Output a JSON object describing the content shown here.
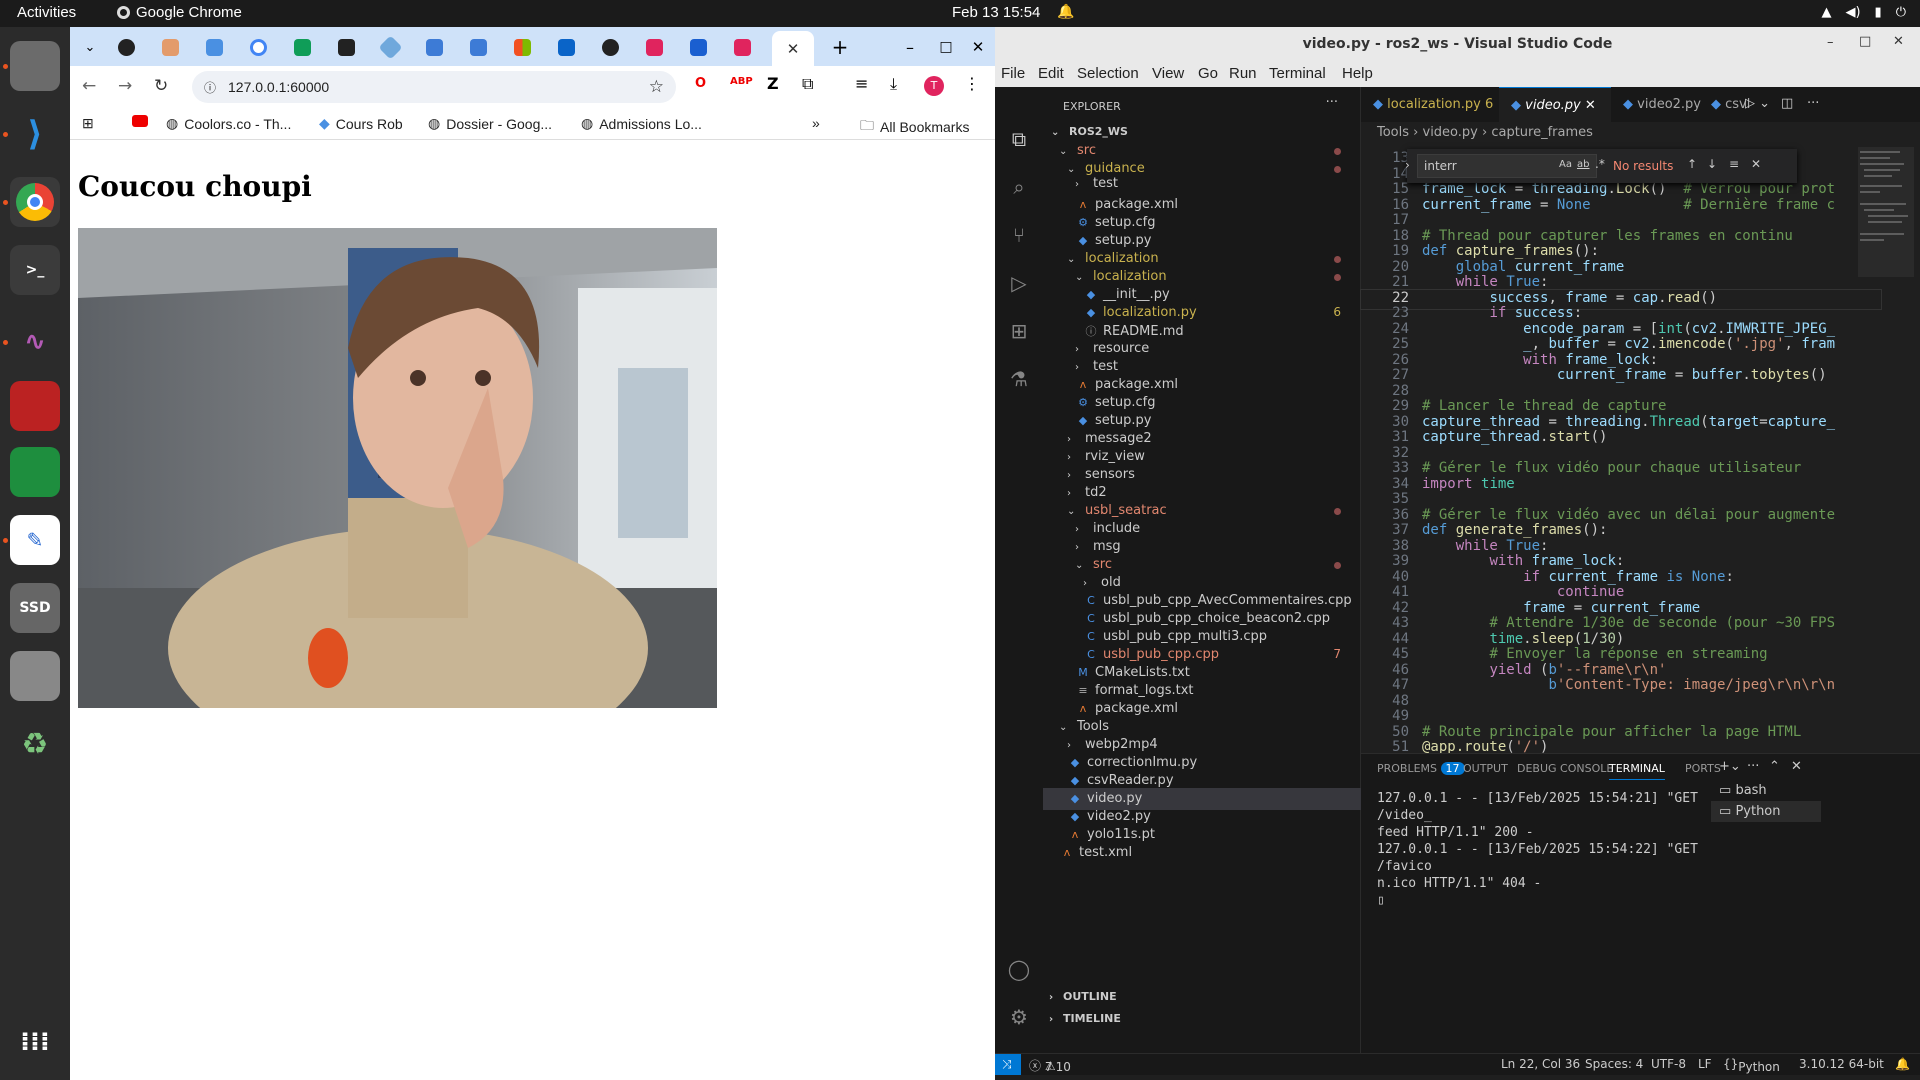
{
  "topbar": {
    "activities": "Activities",
    "app": "Google Chrome",
    "clock": "Feb 13  15:54"
  },
  "browser": {
    "url": "127.0.0.1:60000",
    "all_bookmarks": "All Bookmarks",
    "bookmarks": [
      "Coolors.co - Th...",
      "Cours Rob",
      "Dossier - Goog...",
      "Admissions Lo..."
    ],
    "page_heading": "Coucou choupi",
    "avatar_letter": "T"
  },
  "vscode": {
    "title": "video.py - ros2_ws - Visual Studio Code",
    "menu": [
      "File",
      "Edit",
      "Selection",
      "View",
      "Go",
      "Run",
      "Terminal",
      "Help"
    ],
    "explorer_label": "EXPLORER",
    "tabs": [
      {
        "label": "localization.py",
        "badge": "6"
      },
      {
        "label": "video.py"
      },
      {
        "label": "video2.py"
      },
      {
        "label": "csvl"
      }
    ],
    "breadcrumb": [
      "Tools",
      "video.py",
      "capture_frames"
    ],
    "find": {
      "value": "interr",
      "result": "No results",
      "aa": "Aa",
      "ab": "ab"
    },
    "tree": [
      {
        "label": "ROS2_WS",
        "indent": 0,
        "type": "root",
        "open": true
      },
      {
        "label": "src",
        "indent": 1,
        "type": "folder",
        "open": true,
        "color": "#e2876f",
        "dot": true
      },
      {
        "label": "guidance",
        "indent": 2,
        "type": "folder",
        "open": true,
        "color": "#c9b24e",
        "dot": true
      },
      {
        "label": "test",
        "indent": 3,
        "type": "folder",
        "open": false,
        "clip": true
      },
      {
        "label": "package.xml",
        "indent": 3,
        "type": "xml"
      },
      {
        "label": "setup.cfg",
        "indent": 3,
        "type": "cfg"
      },
      {
        "label": "setup.py",
        "indent": 3,
        "type": "py"
      },
      {
        "label": "localization",
        "indent": 2,
        "type": "folder",
        "open": true,
        "color": "#c9b24e",
        "dot": true
      },
      {
        "label": "localization",
        "indent": 3,
        "type": "folder",
        "open": true,
        "color": "#c9b24e",
        "dot": true
      },
      {
        "label": "__init__.py",
        "indent": 4,
        "type": "py"
      },
      {
        "label": "localization.py",
        "indent": 4,
        "type": "py",
        "color": "#c9b24e",
        "badge": "6"
      },
      {
        "label": "README.md",
        "indent": 4,
        "type": "info"
      },
      {
        "label": "resource",
        "indent": 3,
        "type": "folder",
        "open": false
      },
      {
        "label": "test",
        "indent": 3,
        "type": "folder",
        "open": false
      },
      {
        "label": "package.xml",
        "indent": 3,
        "type": "xml"
      },
      {
        "label": "setup.cfg",
        "indent": 3,
        "type": "cfg"
      },
      {
        "label": "setup.py",
        "indent": 3,
        "type": "py"
      },
      {
        "label": "message2",
        "indent": 2,
        "type": "folder",
        "open": false
      },
      {
        "label": "rviz_view",
        "indent": 2,
        "type": "folder",
        "open": false
      },
      {
        "label": "sensors",
        "indent": 2,
        "type": "folder",
        "open": false
      },
      {
        "label": "td2",
        "indent": 2,
        "type": "folder",
        "open": false
      },
      {
        "label": "usbl_seatrac",
        "indent": 2,
        "type": "folder",
        "open": true,
        "color": "#e2876f",
        "dot": true
      },
      {
        "label": "include",
        "indent": 3,
        "type": "folder",
        "open": false
      },
      {
        "label": "msg",
        "indent": 3,
        "type": "folder",
        "open": false
      },
      {
        "label": "src",
        "indent": 3,
        "type": "folder",
        "open": true,
        "color": "#e2876f",
        "dot": true
      },
      {
        "label": "old",
        "indent": 4,
        "type": "folder",
        "open": false
      },
      {
        "label": "usbl_pub_cpp_AvecCommentaires.cpp",
        "indent": 4,
        "type": "cpp"
      },
      {
        "label": "usbl_pub_cpp_choice_beacon2.cpp",
        "indent": 4,
        "type": "cpp"
      },
      {
        "label": "usbl_pub_cpp_multi3.cpp",
        "indent": 4,
        "type": "cpp"
      },
      {
        "label": "usbl_pub_cpp.cpp",
        "indent": 4,
        "type": "cpp",
        "color": "#e2876f",
        "badge": "7"
      },
      {
        "label": "CMakeLists.txt",
        "indent": 3,
        "type": "cmake"
      },
      {
        "label": "format_logs.txt",
        "indent": 3,
        "type": "txt"
      },
      {
        "label": "package.xml",
        "indent": 3,
        "type": "xml"
      },
      {
        "label": "Tools",
        "indent": 1,
        "type": "folder",
        "open": true
      },
      {
        "label": "webp2mp4",
        "indent": 2,
        "type": "folder",
        "open": false
      },
      {
        "label": "correctionImu.py",
        "indent": 2,
        "type": "py"
      },
      {
        "label": "csvReader.py",
        "indent": 2,
        "type": "py"
      },
      {
        "label": "video.py",
        "indent": 2,
        "type": "py",
        "selected": true
      },
      {
        "label": "video2.py",
        "indent": 2,
        "type": "py"
      },
      {
        "label": "yolo11s.pt",
        "indent": 2,
        "type": "xml"
      },
      {
        "label": "test.xml",
        "indent": 1,
        "type": "xml"
      }
    ],
    "outline": "OUTLINE",
    "timeline": "TIMELINE",
    "code": [
      {
        "n": "13",
        "h": ""
      },
      {
        "n": "14",
        "h": ""
      },
      {
        "n": "15",
        "h": "<span class=va>frame_lock</span> = <span class=va>threading</span>.<span class=fn>Lock</span>()  <span class=cm># Verrou pour prot</span>"
      },
      {
        "n": "16",
        "h": "<span class=va>current_frame</span> = <span class=kw>None</span>           <span class=cm># Dernière frame c</span>"
      },
      {
        "n": "17",
        "h": ""
      },
      {
        "n": "18",
        "h": "<span class=cm># Thread pour capturer les frames en continu</span>"
      },
      {
        "n": "19",
        "h": "<span class=kw>def</span> <span class=fn>capture_frames</span>():"
      },
      {
        "n": "20",
        "h": "    <span class=kw>global</span> <span class=va>current_frame</span>"
      },
      {
        "n": "21",
        "h": "    <span class=kc>while</span> <span class=kw>True</span>:"
      },
      {
        "n": "22",
        "h": "        <span class=va>success</span>, <span class=va>frame</span> = <span class=va>cap</span>.<span class=fn>read</span>()",
        "cur": true
      },
      {
        "n": "23",
        "h": "        <span class=kc>if</span> <span class=va>success</span>:"
      },
      {
        "n": "24",
        "h": "            <span class=va>encode_param</span> = [<span class=cls>int</span>(<span class=va>cv2</span>.<span class=va>IMWRITE_JPEG_</span>"
      },
      {
        "n": "25",
        "h": "            <span class=va>_</span>, <span class=va>buffer</span> = <span class=va>cv2</span>.<span class=fn>imencode</span>(<span class=st>'.jpg'</span>, <span class=va>fram</span>"
      },
      {
        "n": "26",
        "h": "            <span class=kc>with</span> <span class=va>frame_lock</span>:"
      },
      {
        "n": "27",
        "h": "                <span class=va>current_frame</span> = <span class=va>buffer</span>.<span class=fn>tobytes</span>()"
      },
      {
        "n": "28",
        "h": ""
      },
      {
        "n": "29",
        "h": "<span class=cm># Lancer le thread de capture</span>"
      },
      {
        "n": "30",
        "h": "<span class=va>capture_thread</span> = <span class=va>threading</span>.<span class=cls>Thread</span>(<span class=va>target</span>=<span class=va>capture_</span>"
      },
      {
        "n": "31",
        "h": "<span class=va>capture_thread</span>.<span class=fn>start</span>()"
      },
      {
        "n": "32",
        "h": ""
      },
      {
        "n": "33",
        "h": "<span class=cm># Gérer le flux vidéo pour chaque utilisateur</span>"
      },
      {
        "n": "34",
        "h": "<span class=kc>import</span> <span class=cls>time</span>"
      },
      {
        "n": "35",
        "h": ""
      },
      {
        "n": "36",
        "h": "<span class=cm># Gérer le flux vidéo avec un délai pour augmente</span>"
      },
      {
        "n": "37",
        "h": "<span class=kw>def</span> <span class=fn>generate_frames</span>():"
      },
      {
        "n": "38",
        "h": "    <span class=kc>while</span> <span class=kw>True</span>:"
      },
      {
        "n": "39",
        "h": "        <span class=kc>with</span> <span class=va>frame_lock</span>:"
      },
      {
        "n": "40",
        "h": "            <span class=kc>if</span> <span class=va>current_frame</span> <span class=kw>is</span> <span class=kw>None</span>:"
      },
      {
        "n": "41",
        "h": "                <span class=kc>continue</span>"
      },
      {
        "n": "42",
        "h": "            <span class=va>frame</span> = <span class=va>current_frame</span>"
      },
      {
        "n": "43",
        "h": "        <span class=cm># Attendre 1/30e de seconde (pour ~30 FPS</span>"
      },
      {
        "n": "44",
        "h": "        <span class=cls>time</span>.<span class=fn>sleep</span>(<span class=nu>1</span>/<span class=nu>30</span>)"
      },
      {
        "n": "45",
        "h": "        <span class=cm># Envoyer la réponse en streaming</span>"
      },
      {
        "n": "46",
        "h": "        <span class=kc>yield</span> (<span class=kw>b</span><span class=st>'--frame\\r\\n'</span>"
      },
      {
        "n": "47",
        "h": "               <span class=kw>b</span><span class=st>'Content-Type: image/jpeg\\r\\n\\r\\n</span>"
      },
      {
        "n": "48",
        "h": ""
      },
      {
        "n": "49",
        "h": ""
      },
      {
        "n": "50",
        "h": "<span class=cm># Route principale pour afficher la page HTML</span>"
      },
      {
        "n": "51",
        "h": "<span class=fn>@app.route</span>(<span class=st>'/'</span>)"
      },
      {
        "n": "52",
        "h": "<span class=kw>def</span> <span class=fn>index</span>():"
      },
      {
        "n": "53",
        "h": "    <span class=kc>return</span> <span class=fn>render_template_string</span>(<span class=st>'''</span>"
      }
    ],
    "panel": {
      "tabs": [
        "PROBLEMS",
        "OUTPUT",
        "DEBUG CONSOLE",
        "TERMINAL",
        "PORTS"
      ],
      "problems_count": "17",
      "terminal_lines": [
        "127.0.0.1 - - [13/Feb/2025 15:54:21] \"GET /video_",
        "feed HTTP/1.1\" 200 -",
        "127.0.0.1 - - [13/Feb/2025 15:54:22] \"GET /favico",
        "n.ico HTTP/1.1\" 404 -"
      ],
      "shells": [
        "bash",
        "Python"
      ]
    },
    "status": {
      "errors": "7",
      "warnings": "10",
      "position": "Ln 22, Col 36",
      "spaces": "Spaces: 4",
      "encoding": "UTF-8",
      "eol": "LF",
      "lang": "Python",
      "interp": "3.10.12 64-bit"
    }
  }
}
